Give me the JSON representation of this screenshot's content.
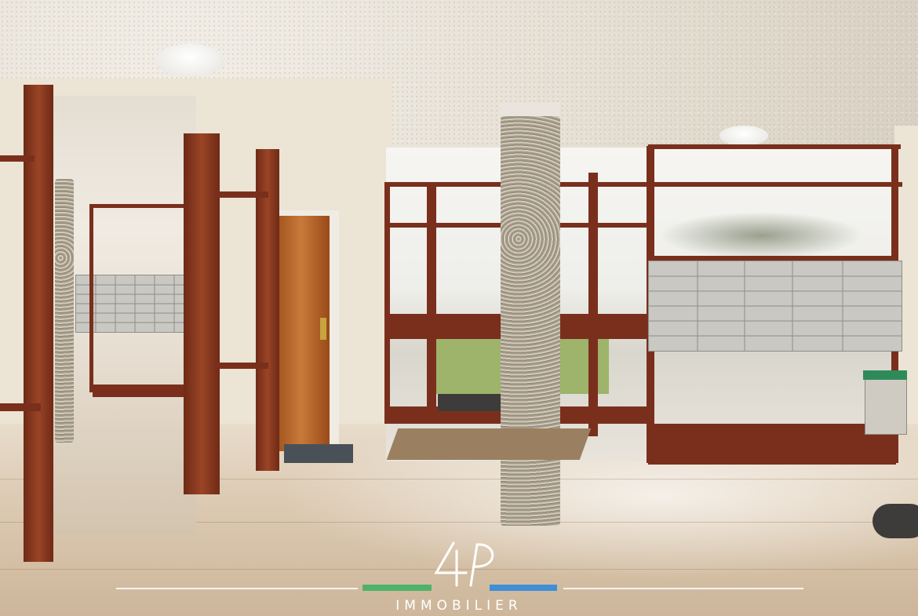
{
  "scene": {
    "description_colors": {
      "wood": "#7a2f1d",
      "ceiling": "#e6e0d5",
      "floor": "#dccab2",
      "brand_green": "#4fb26a",
      "brand_blue": "#3f8fd6"
    }
  },
  "watermark": {
    "logo_text": "4P",
    "brand_name": "IMMOBILIER"
  }
}
